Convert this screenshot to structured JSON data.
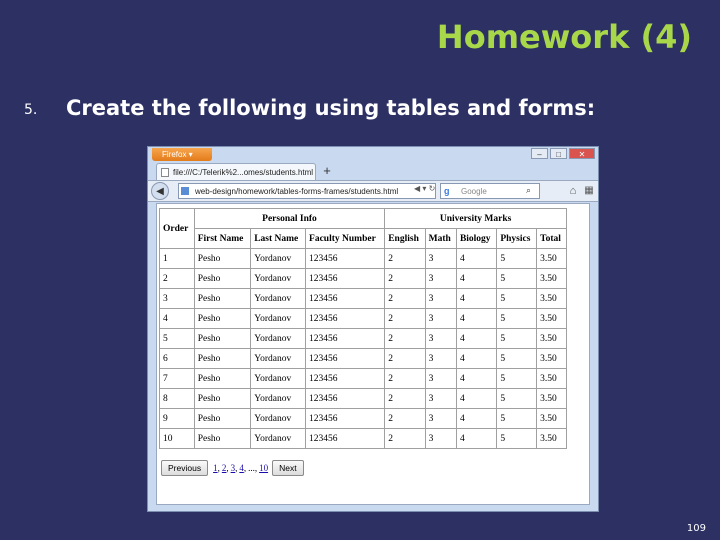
{
  "slide": {
    "title": "Homework (4)",
    "bullet_number": "5.",
    "bullet_text": "Create the following using tables and forms:",
    "page_number": "109"
  },
  "browser": {
    "menu_button": "Firefox",
    "tab_title": "file:///C:/Telerik%2...omes/students.html",
    "newtab": "+",
    "url": "web-design/homework/tables-forms-frames/students.html",
    "search_placeholder": "Google",
    "controls": {
      "minimize": "–",
      "maximize": "□",
      "close": "✕"
    }
  },
  "table": {
    "order_header": "Order",
    "group_headers": [
      "Personal Info",
      "University Marks"
    ],
    "columns": [
      "First Name",
      "Last Name",
      "Faculty Number",
      "English",
      "Math",
      "Biology",
      "Physics",
      "Total"
    ],
    "rows": [
      [
        "1",
        "Pesho",
        "Yordanov",
        "123456",
        "2",
        "3",
        "4",
        "5",
        "3.50"
      ],
      [
        "2",
        "Pesho",
        "Yordanov",
        "123456",
        "2",
        "3",
        "4",
        "5",
        "3.50"
      ],
      [
        "3",
        "Pesho",
        "Yordanov",
        "123456",
        "2",
        "3",
        "4",
        "5",
        "3.50"
      ],
      [
        "4",
        "Pesho",
        "Yordanov",
        "123456",
        "2",
        "3",
        "4",
        "5",
        "3.50"
      ],
      [
        "5",
        "Pesho",
        "Yordanov",
        "123456",
        "2",
        "3",
        "4",
        "5",
        "3.50"
      ],
      [
        "6",
        "Pesho",
        "Yordanov",
        "123456",
        "2",
        "3",
        "4",
        "5",
        "3.50"
      ],
      [
        "7",
        "Pesho",
        "Yordanov",
        "123456",
        "2",
        "3",
        "4",
        "5",
        "3.50"
      ],
      [
        "8",
        "Pesho",
        "Yordanov",
        "123456",
        "2",
        "3",
        "4",
        "5",
        "3.50"
      ],
      [
        "9",
        "Pesho",
        "Yordanov",
        "123456",
        "2",
        "3",
        "4",
        "5",
        "3.50"
      ],
      [
        "10",
        "Pesho",
        "Yordanov",
        "123456",
        "2",
        "3",
        "4",
        "5",
        "3.50"
      ]
    ]
  },
  "pager": {
    "previous": "Previous",
    "pages": [
      "1",
      "2",
      "3",
      "4",
      "...",
      "10"
    ],
    "next": "Next"
  }
}
